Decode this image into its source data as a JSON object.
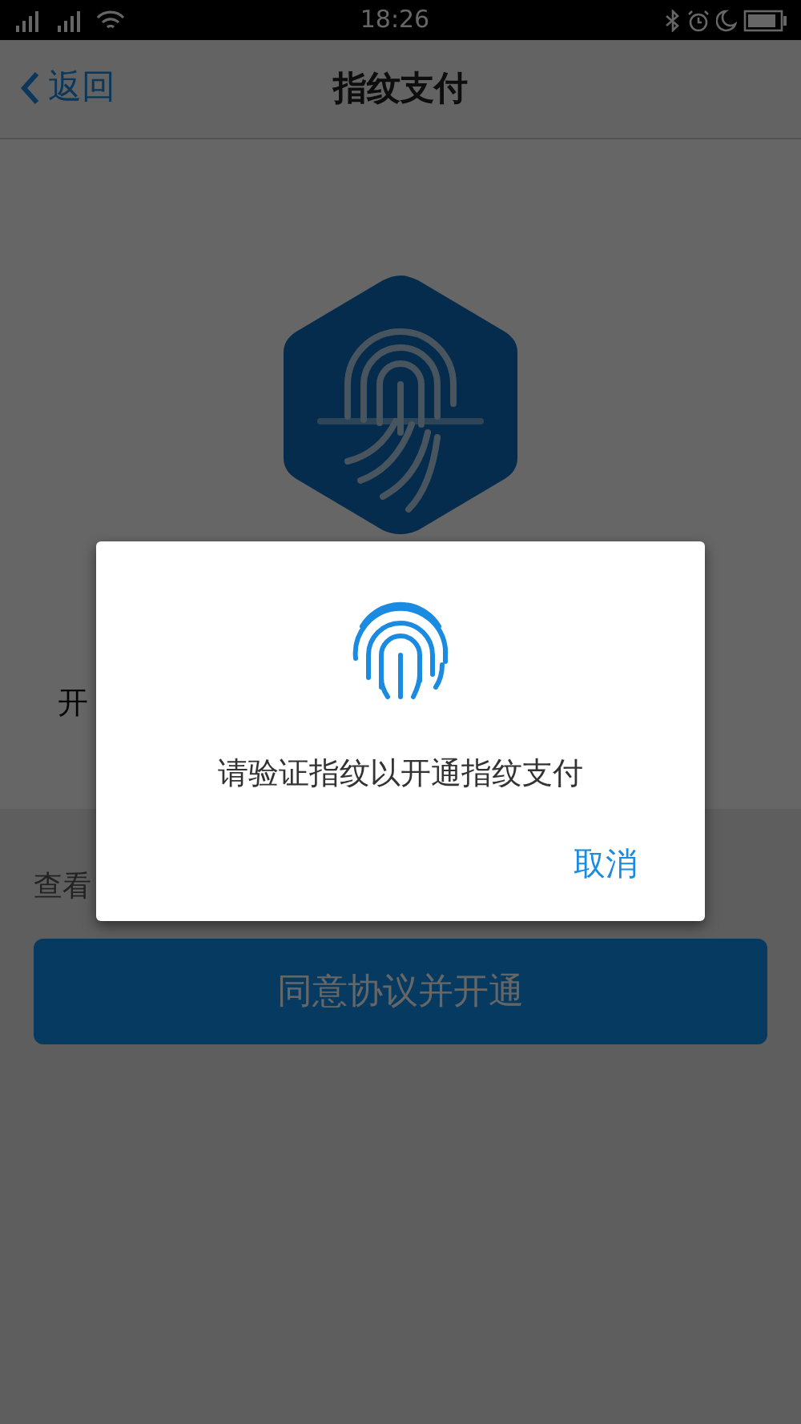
{
  "status_bar": {
    "time": "18:26"
  },
  "nav": {
    "back": "返回",
    "title": "指纹支付"
  },
  "intro": {
    "text": "开"
  },
  "agreement": {
    "text": "查看"
  },
  "primary_button": {
    "label": "同意协议并开通"
  },
  "dialog": {
    "message": "请验证指纹以开通指纹支付",
    "cancel": "取消"
  }
}
